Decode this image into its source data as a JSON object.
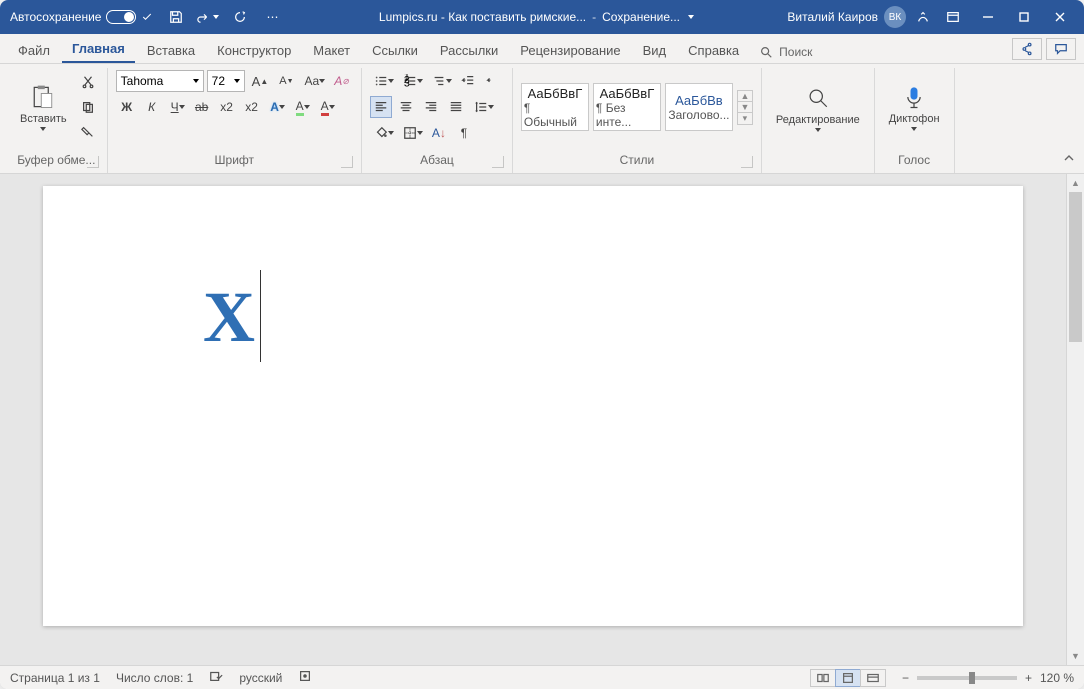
{
  "titlebar": {
    "autosave": "Автосохранение",
    "doc_title": "Lumpics.ru - Как поставить римские...",
    "saving": "Сохранение...",
    "user": "Виталий Каиров",
    "initials": "ВК"
  },
  "tabs": {
    "file": "Файл",
    "home": "Главная",
    "insert": "Вставка",
    "design": "Конструктор",
    "layout": "Макет",
    "references": "Ссылки",
    "mailings": "Рассылки",
    "review": "Рецензирование",
    "view": "Вид",
    "help": "Справка",
    "search": "Поиск"
  },
  "ribbon": {
    "clipboard": {
      "label": "Буфер обме...",
      "paste": "Вставить"
    },
    "font": {
      "label": "Шрифт",
      "name": "Tahoma",
      "size": "72"
    },
    "para": {
      "label": "Абзац"
    },
    "styles": {
      "label": "Стили",
      "s1": "АаБбВвГ",
      "s1n": "¶ Обычный",
      "s2": "АаБбВвГ",
      "s2n": "¶ Без инте...",
      "s3": "АаБбВв",
      "s3n": "Заголово..."
    },
    "editing": {
      "label": "Редактирование"
    },
    "voice": {
      "label": "Голос",
      "btn": "Диктофон"
    }
  },
  "document": {
    "char": "X"
  },
  "status": {
    "page": "Страница 1 из 1",
    "words": "Число слов: 1",
    "lang": "русский",
    "zoom": "120 %"
  }
}
